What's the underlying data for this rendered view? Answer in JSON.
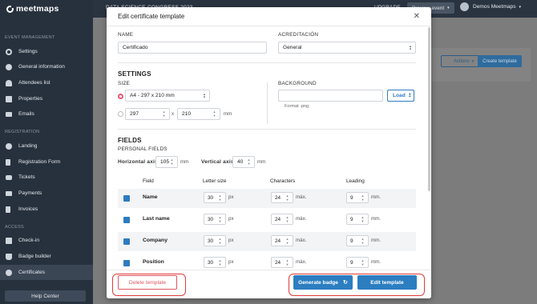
{
  "app": {
    "brand": "meetmaps"
  },
  "sidebar": {
    "sections": [
      {
        "label": "EVENT MANAGEMENT"
      },
      {
        "label": "REGISTRATION"
      },
      {
        "label": "ACCESS"
      }
    ],
    "items": [
      {
        "label": "Settings",
        "icon": "gear-icon"
      },
      {
        "label": "General information",
        "icon": "info-icon"
      },
      {
        "label": "Attendees list",
        "icon": "users-icon"
      },
      {
        "label": "Properties",
        "icon": "properties-icon"
      },
      {
        "label": "Emails",
        "icon": "mail-icon"
      },
      {
        "label": "Landing",
        "icon": "globe-icon"
      },
      {
        "label": "Registration Form",
        "icon": "form-icon"
      },
      {
        "label": "Tickets",
        "icon": "ticket-icon"
      },
      {
        "label": "Payments",
        "icon": "card-icon"
      },
      {
        "label": "Invoices",
        "icon": "invoice-icon"
      },
      {
        "label": "Check-in",
        "icon": "check-in-icon"
      },
      {
        "label": "Badge builder",
        "icon": "badge-icon"
      },
      {
        "label": "Certificates",
        "icon": "certificate-icon"
      }
    ],
    "active": "Certificates",
    "help": "Help Center"
  },
  "topbar": {
    "event": "DATA SCIENCE CONGRESS 2023",
    "upgrade": "UPGRADE",
    "preview": "Preview event",
    "user": "Demos Meetmaps"
  },
  "background": {
    "actions": "Actions",
    "create": "Create template"
  },
  "modal": {
    "title": "Edit certificate template",
    "name_label": "NAME",
    "name_value": "Certificado",
    "accreditation_label": "ACREDITACIÓN",
    "accreditation_value": "General",
    "settings_heading": "SETTINGS",
    "size_label": "SIZE",
    "size_preset": "A4 - 297 x 210 mm",
    "custom_width": "297",
    "custom_x": "x",
    "custom_height": "210",
    "custom_unit": "mm",
    "background_label": "BACKGROUND",
    "load_label": "Load",
    "format_note": "Format .png",
    "fields_heading": "FIELDS",
    "personal_fields_label": "PERSONAL FIELDS",
    "horizontal_axis_label": "Horizontal axis",
    "horizontal_axis_value": "105",
    "vertical_axis_label": "Vertical axis",
    "vertical_axis_value": "40",
    "axis_unit": "mm",
    "columns": [
      "Field",
      "Letter size",
      "Characters",
      "Leading"
    ],
    "rows": [
      {
        "field": "Name",
        "letter_size": "30",
        "characters": "24",
        "leading": "9"
      },
      {
        "field": "Last name",
        "letter_size": "30",
        "characters": "24",
        "leading": "9"
      },
      {
        "field": "Company",
        "letter_size": "30",
        "characters": "24",
        "leading": "9"
      },
      {
        "field": "Position",
        "letter_size": "30",
        "characters": "24",
        "leading": "9"
      }
    ],
    "unit_px": "px",
    "unit_max": "máx.",
    "unit_mm": "mm.",
    "delete_label": "Delete template",
    "generate_label": "Generate badge",
    "edit_label": "Edit template"
  },
  "colors": {
    "accent": "#2c7ec1",
    "danger": "#e05664",
    "sidebar": "#27313d",
    "highlight": "#e23b3b"
  }
}
